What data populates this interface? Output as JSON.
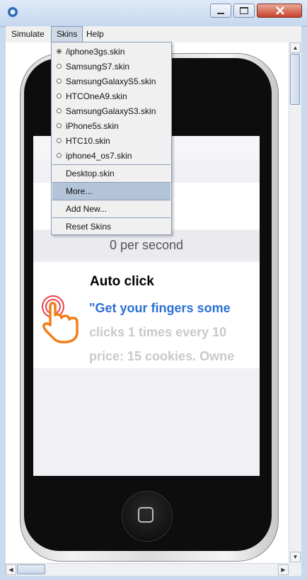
{
  "menubar": {
    "items": [
      "Simulate",
      "Skins",
      "Help"
    ]
  },
  "skins_menu": {
    "skins": [
      {
        "label": "/iphone3gs.skin",
        "selected": true
      },
      {
        "label": "SamsungS7.skin",
        "selected": false
      },
      {
        "label": "SamsungGalaxyS5.skin",
        "selected": false
      },
      {
        "label": "HTCOneA9.skin",
        "selected": false
      },
      {
        "label": "SamsungGalaxyS3.skin",
        "selected": false
      },
      {
        "label": "iPhone5s.skin",
        "selected": false
      },
      {
        "label": "HTC10.skin",
        "selected": false
      },
      {
        "label": "iphone4_os7.skin",
        "selected": false
      }
    ],
    "desktop": "Desktop.skin",
    "more": "More...",
    "add_new": "Add New...",
    "reset": "Reset Skins"
  },
  "app": {
    "rate": "0 per second",
    "auto_click": {
      "title": "Auto click",
      "quote": "\"Get your fingers some",
      "desc": "clicks 1 times every 10",
      "price": "price: 15 cookies. Owne"
    }
  },
  "colors": {
    "link_blue": "#2a6fd6",
    "hand_orange": "#f07f1a",
    "menu_highlight": "#b4c4d8"
  }
}
